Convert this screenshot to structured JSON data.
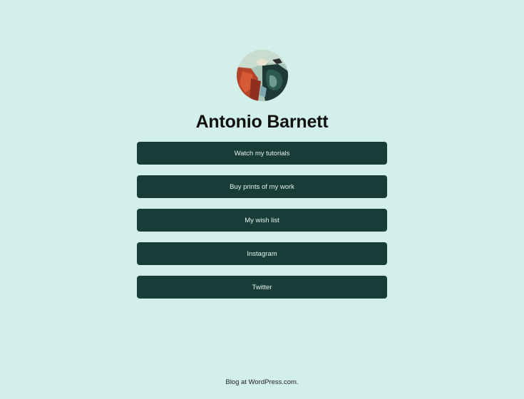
{
  "profile": {
    "name": "Antonio Barnett"
  },
  "links": [
    {
      "label": "Watch my tutorials"
    },
    {
      "label": "Buy prints of my work"
    },
    {
      "label": "My wish list"
    },
    {
      "label": "Instagram"
    },
    {
      "label": "Twitter"
    }
  ],
  "footer": {
    "text": "Blog at WordPress.com."
  },
  "colors": {
    "background": "#d3efe9",
    "button": "#183d38",
    "button_text": "#e6f2ef",
    "heading": "#111111"
  }
}
